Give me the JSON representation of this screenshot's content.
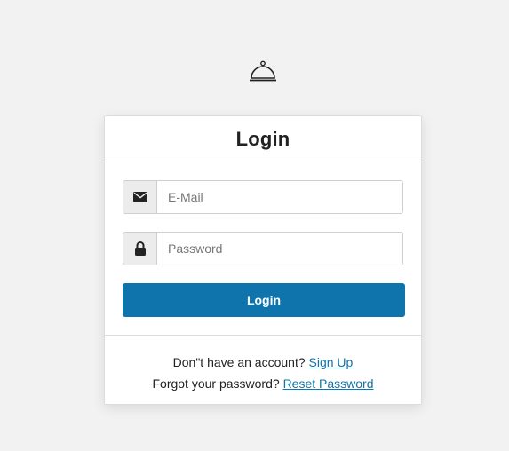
{
  "card": {
    "title": "Login",
    "email": {
      "placeholder": "E-Mail",
      "value": ""
    },
    "password": {
      "placeholder": "Password",
      "value": ""
    },
    "login_button": "Login",
    "footer": {
      "signup_prompt": "Don\"t have an account?",
      "signup_link": "Sign Up",
      "reset_prompt": "Forgot your password?",
      "reset_link": "Reset Password"
    }
  },
  "icons": {
    "logo": "cloche-icon",
    "email": "envelope-icon",
    "password": "lock-icon"
  },
  "colors": {
    "background": "#f2f2f2",
    "primary": "#0e74ab",
    "addon": "#ececec"
  }
}
